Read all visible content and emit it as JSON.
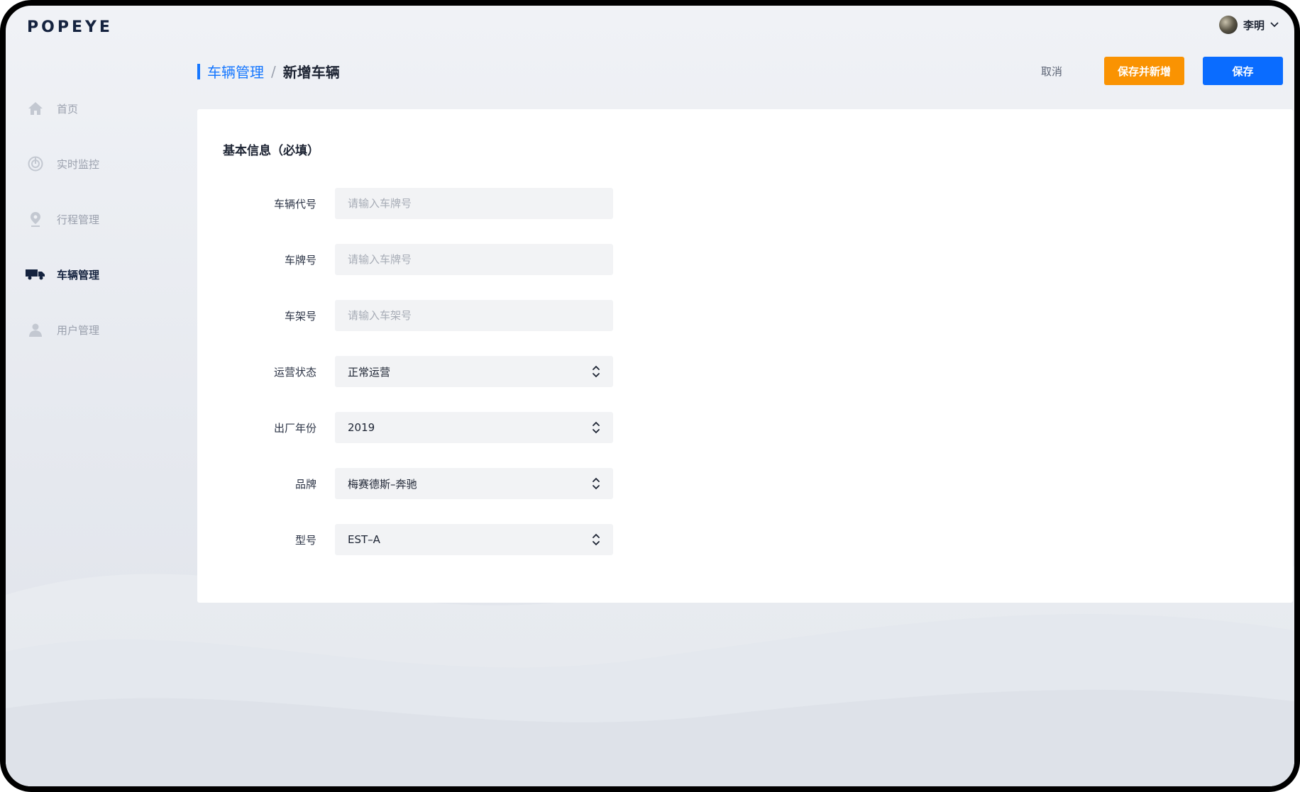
{
  "app": {
    "logo": "POPEYE"
  },
  "user": {
    "name": "李明"
  },
  "sidebar": {
    "items": [
      {
        "label": "首页",
        "icon": "home-icon",
        "active": false
      },
      {
        "label": "实时监控",
        "icon": "radar-icon",
        "active": false
      },
      {
        "label": "行程管理",
        "icon": "location-pin-icon",
        "active": false
      },
      {
        "label": "车辆管理",
        "icon": "truck-icon",
        "active": true
      },
      {
        "label": "用户管理",
        "icon": "user-icon",
        "active": false
      }
    ]
  },
  "breadcrumb": {
    "parent": "车辆管理",
    "separator": "/",
    "current": "新增车辆"
  },
  "actions": {
    "cancel": "取消",
    "save_and_new": "保存并新增",
    "save": "保存"
  },
  "form": {
    "section_title": "基本信息（必填）",
    "vehicle_code": {
      "label": "车辆代号",
      "placeholder": "请输入车牌号",
      "value": ""
    },
    "plate": {
      "label": "车牌号",
      "placeholder": "请输入车牌号",
      "value": ""
    },
    "frame": {
      "label": "车架号",
      "placeholder": "请输入车架号",
      "value": ""
    },
    "status": {
      "label": "运营状态",
      "value": "正常运营"
    },
    "year": {
      "label": "出厂年份",
      "value": "2019"
    },
    "brand": {
      "label": "品牌",
      "value": "梅赛德斯–奔驰"
    },
    "model": {
      "label": "型号",
      "value": "EST–A"
    }
  },
  "colors": {
    "primary": "#0a6cff",
    "accent": "#fa9302",
    "link": "#1677ff",
    "brand_dark": "#15233f"
  }
}
